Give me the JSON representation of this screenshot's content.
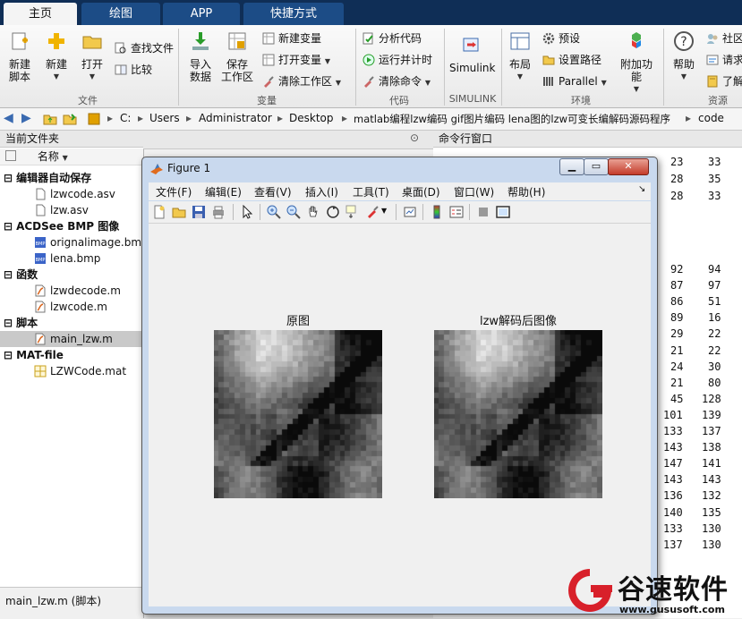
{
  "tabs": [
    {
      "label": "主页",
      "active": true
    },
    {
      "label": "绘图",
      "active": false
    },
    {
      "label": "APP",
      "active": false
    },
    {
      "label": "快捷方式",
      "active": false
    }
  ],
  "ribbon": {
    "new_script": "新建\n脚本",
    "new_script_l1": "新建",
    "new_script_l2": "脚本",
    "new": "新建",
    "open": "打开",
    "find_files": "查找文件",
    "compare": "比较",
    "import_data_l1": "导入",
    "import_data_l2": "数据",
    "save_ws_l1": "保存",
    "save_ws_l2": "工作区",
    "new_variable": "新建变量",
    "open_variable": "打开变量",
    "clear_workspace": "清除工作区",
    "analyze_code": "分析代码",
    "run_and_time": "运行并计时",
    "clear_commands": "清除命令",
    "simulink": "Simulink",
    "layout": "布局",
    "preferences": "预设",
    "set_path": "设置路径",
    "parallel": "Parallel",
    "addons": "附加功能",
    "help": "帮助",
    "community": "社区",
    "request_support": "请求",
    "learn": "了解",
    "sections": {
      "file": "文件",
      "variable": "变量",
      "code": "代码",
      "simulink": "SIMULINK",
      "environment": "环境",
      "resources": "资源"
    }
  },
  "address": {
    "path": [
      "C:",
      "Users",
      "Administrator",
      "Desktop",
      "matlab编程lzw编码 gif图片编码 lena图的lzw可变长编解码源码程序",
      "code"
    ]
  },
  "filebrowser": {
    "title": "当前文件夹",
    "column_name": "名称",
    "groups": [
      {
        "label": "编辑器自动保存",
        "files": [
          "lzwcode.asv",
          "lzw.asv"
        ]
      },
      {
        "label": "ACDSee BMP 图像",
        "files": [
          "orignalimage.bmp",
          "lena.bmp"
        ]
      },
      {
        "label": "函数",
        "files": [
          "lzwdecode.m",
          "lzwcode.m"
        ]
      },
      {
        "label": "脚本",
        "files": [
          "main_lzw.m"
        ]
      },
      {
        "label": "MAT-file",
        "files": [
          "LZWCode.mat"
        ]
      }
    ],
    "status": "main_lzw.m  (脚本)"
  },
  "command_window": {
    "title": "命令行窗口",
    "col1": [
      "23",
      "28",
      "28",
      "",
      "",
      "",
      "",
      "92",
      "87",
      "86",
      "89",
      "29",
      "21",
      "24",
      "21",
      "45",
      "101",
      "133",
      "143",
      "147",
      "143",
      "136",
      "140",
      "133",
      "137"
    ],
    "col2": [
      "33",
      "35",
      "33",
      "",
      "",
      "",
      "",
      "94",
      "97",
      "51",
      "16",
      "22",
      "22",
      "30",
      "80",
      "128",
      "139",
      "137",
      "138",
      "141",
      "143",
      "132",
      "135",
      "130",
      "130"
    ]
  },
  "figure": {
    "title": "Figure 1",
    "menu": [
      "文件(F)",
      "编辑(E)",
      "查看(V)",
      "插入(I)",
      "工具(T)",
      "桌面(D)",
      "窗口(W)",
      "帮助(H)"
    ],
    "left_title": "原图",
    "right_title": "lzw解码后图像"
  },
  "watermark": {
    "name": "谷速软件",
    "url": "www.gususoft.com"
  },
  "colors": {
    "tabstrip": "#0f2e56",
    "tab": "#1c4c86",
    "watermark_red": "#d8202a"
  }
}
